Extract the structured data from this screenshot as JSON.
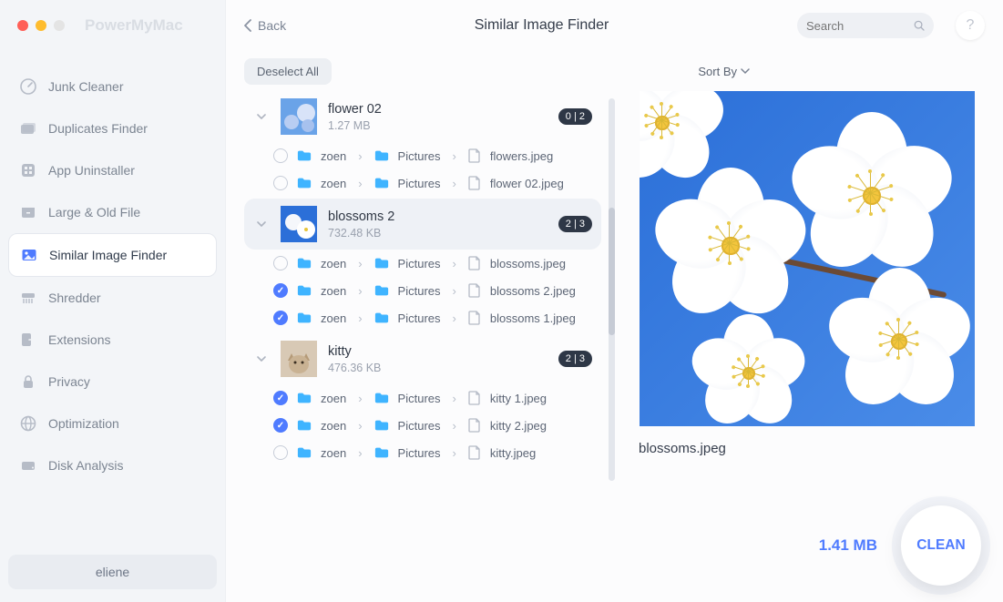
{
  "brand": "PowerMyMac",
  "back_label": "Back",
  "title": "Similar Image Finder",
  "search_placeholder": "Search",
  "help_label": "?",
  "sidebar": {
    "items": [
      {
        "label": "Junk Cleaner",
        "icon": "gauge-icon"
      },
      {
        "label": "Duplicates Finder",
        "icon": "folder-stack-icon"
      },
      {
        "label": "App Uninstaller",
        "icon": "grid-icon"
      },
      {
        "label": "Large & Old File",
        "icon": "archive-icon"
      },
      {
        "label": "Similar Image Finder",
        "icon": "image-icon"
      },
      {
        "label": "Shredder",
        "icon": "shredder-icon"
      },
      {
        "label": "Extensions",
        "icon": "arrow-out-icon"
      },
      {
        "label": "Privacy",
        "icon": "lock-icon"
      },
      {
        "label": "Optimization",
        "icon": "globe-icon"
      },
      {
        "label": "Disk Analysis",
        "icon": "disk-icon"
      }
    ],
    "active_index": 4
  },
  "user": "eliene",
  "deselect_label": "Deselect All",
  "sort_label": "Sort By",
  "groups": [
    {
      "name": "flower 02",
      "size": "1.27 MB",
      "badge": "0 | 2",
      "selected": false,
      "thumb": "flowers-blue",
      "files": [
        {
          "checked": false,
          "path": [
            "zoen",
            "Pictures"
          ],
          "file": "flowers.jpeg"
        },
        {
          "checked": false,
          "path": [
            "zoen",
            "Pictures"
          ],
          "file": "flower 02.jpeg"
        }
      ]
    },
    {
      "name": "blossoms 2",
      "size": "732.48 KB",
      "badge": "2 | 3",
      "selected": true,
      "thumb": "blossoms",
      "files": [
        {
          "checked": false,
          "path": [
            "zoen",
            "Pictures"
          ],
          "file": "blossoms.jpeg"
        },
        {
          "checked": true,
          "path": [
            "zoen",
            "Pictures"
          ],
          "file": "blossoms 2.jpeg"
        },
        {
          "checked": true,
          "path": [
            "zoen",
            "Pictures"
          ],
          "file": "blossoms 1.jpeg"
        }
      ]
    },
    {
      "name": "kitty",
      "size": "476.36 KB",
      "badge": "2 | 3",
      "selected": false,
      "thumb": "kitty",
      "files": [
        {
          "checked": true,
          "path": [
            "zoen",
            "Pictures"
          ],
          "file": "kitty 1.jpeg"
        },
        {
          "checked": true,
          "path": [
            "zoen",
            "Pictures"
          ],
          "file": "kitty 2.jpeg"
        },
        {
          "checked": false,
          "path": [
            "zoen",
            "Pictures"
          ],
          "file": "kitty.jpeg"
        }
      ]
    }
  ],
  "preview": {
    "filename": "blossoms.jpeg"
  },
  "total_size": "1.41 MB",
  "clean_label": "CLEAN",
  "arrow_annotation": {
    "color": "#e2231a"
  }
}
